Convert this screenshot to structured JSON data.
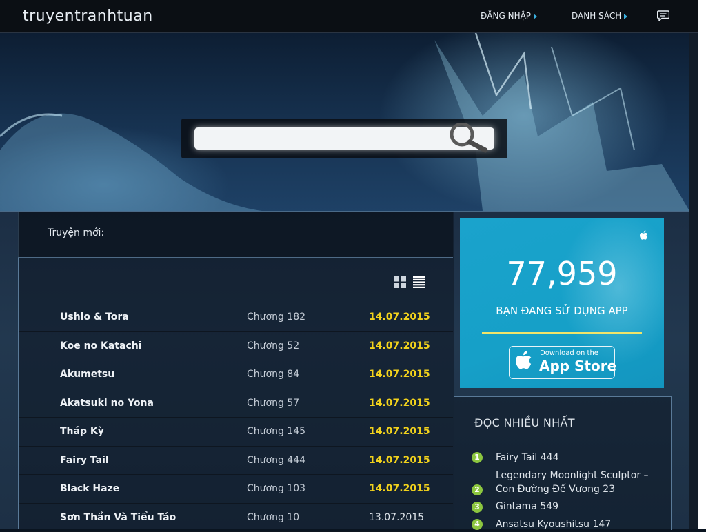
{
  "header": {
    "logo": "truyentranhtuan",
    "nav": [
      {
        "label": "ĐĂNG NHẬP"
      },
      {
        "label": "DANH SÁCH"
      }
    ],
    "chat_icon": "chat-bubble-icon"
  },
  "search": {
    "placeholder": "",
    "icon": "magnifier-icon"
  },
  "new_manga": {
    "title": "Truyện mới:",
    "view_icons": [
      "grid-view-icon",
      "list-view-icon"
    ],
    "rows": [
      {
        "name": "Ushio & Tora",
        "chapter": "Chương 182",
        "date": "14.07.2015"
      },
      {
        "name": "Koe no Katachi",
        "chapter": "Chương 52",
        "date": "14.07.2015"
      },
      {
        "name": "Akumetsu",
        "chapter": "Chương 84",
        "date": "14.07.2015"
      },
      {
        "name": "Akatsuki no Yona",
        "chapter": "Chương 57",
        "date": "14.07.2015"
      },
      {
        "name": "Tháp Kỳ",
        "chapter": "Chương 145",
        "date": "14.07.2015"
      },
      {
        "name": "Fairy Tail",
        "chapter": "Chương 444",
        "date": "14.07.2015"
      },
      {
        "name": "Black Haze",
        "chapter": "Chương 103",
        "date": "14.07.2015"
      },
      {
        "name": "Sơn Thần Và Tiểu Táo",
        "chapter": "Chương 10",
        "date": "13.07.2015"
      }
    ],
    "highlight_color": "#f2d21c"
  },
  "app_promo": {
    "count": "77,959",
    "subtitle": "BẠN ĐANG SỬ DỤNG APP",
    "store_small": "Download on the",
    "store_big": "App Store",
    "accent": "#16a0c8"
  },
  "popular": {
    "title": "ĐỌC NHIỀU NHẤT",
    "items": [
      {
        "num": "1",
        "text": "Fairy Tail 444"
      },
      {
        "num": "2",
        "text": "Legendary Moonlight Sculptor – Con Đường Đế Vương 23"
      },
      {
        "num": "3",
        "text": "Gintama 549"
      },
      {
        "num": "4",
        "text": "Ansatsu Kyoushitsu 147"
      }
    ],
    "badge_color": "#8cc63f"
  }
}
